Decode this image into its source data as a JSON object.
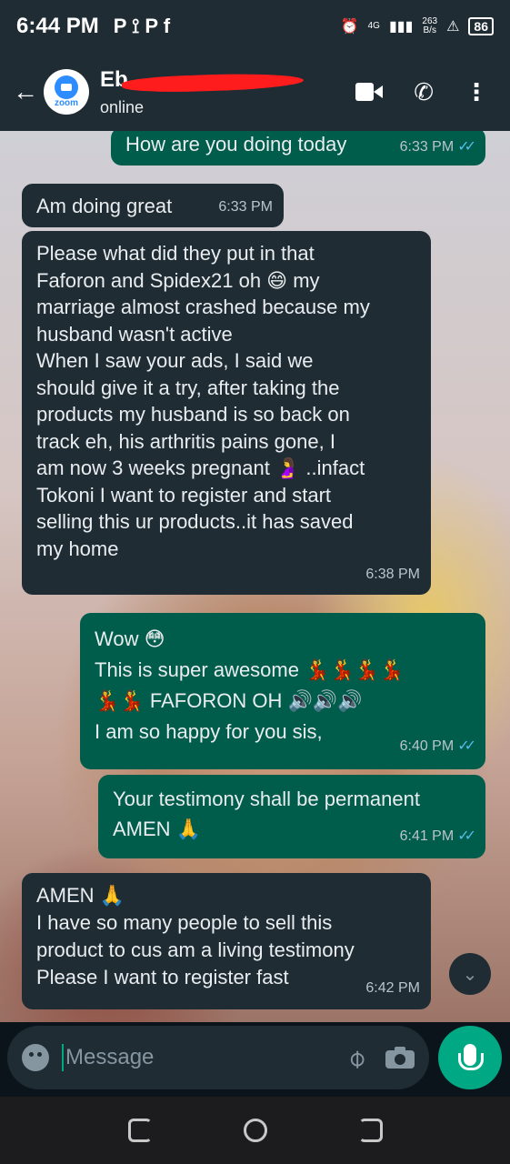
{
  "status_bar": {
    "time": "6:44 PM",
    "notifications": "P ⟟ P f",
    "network": "4G",
    "speed": "263",
    "speed_unit": "B/s",
    "battery": "86"
  },
  "header": {
    "avatar_text": "zoom",
    "contact_name": "Eb",
    "contact_status": "online"
  },
  "messages": [
    {
      "direction": "out",
      "text": "How are you doing today",
      "time": "6:33 PM"
    },
    {
      "direction": "in",
      "text": "Am doing great",
      "time": "6:33 PM"
    },
    {
      "direction": "in",
      "lines": [
        "Please what did they put in that",
        "Faforon and Spidex21 oh 😄 my",
        "marriage almost crashed because my",
        "husband wasn't active",
        "When I saw your ads, I said we",
        "should give it a try, after taking the",
        "products my husband is so back on",
        "track eh,  his arthritis pains gone, I",
        "am now 3 weeks pregnant 🤰 ..infact",
        "Tokoni I want to register and start",
        "selling this ur products..it has saved",
        "my home"
      ],
      "time": "6:38 PM"
    },
    {
      "direction": "out",
      "lines": [
        "Wow 😳",
        "This is super awesome 💃💃💃💃",
        "💃💃 FAFORON OH 🔊🔊🔊",
        "I am so happy for you sis,"
      ],
      "time": "6:40 PM"
    },
    {
      "direction": "out",
      "lines": [
        "Your testimony shall be permanent",
        "AMEN 🙏"
      ],
      "time": "6:41 PM"
    },
    {
      "direction": "in",
      "lines": [
        "AMEN 🙏",
        "I have so many people to sell this",
        "product to cus am a living testimony",
        "Please I want to register fast"
      ],
      "time": "6:42 PM"
    }
  ],
  "composer": {
    "placeholder": "Message"
  },
  "icons": {
    "back": "back-arrow-icon",
    "video": "video-call-icon",
    "call": "phone-icon",
    "menu": "more-options-icon",
    "emoji": "emoji-icon",
    "attach": "paperclip-icon",
    "camera": "camera-icon",
    "mic": "microphone-icon"
  },
  "colors": {
    "header_bg": "#1f2c34",
    "incoming_bubble": "#1f2c34",
    "outgoing_bubble": "#005c4b",
    "accent": "#00a884",
    "read_ticks": "#53bdeb"
  }
}
